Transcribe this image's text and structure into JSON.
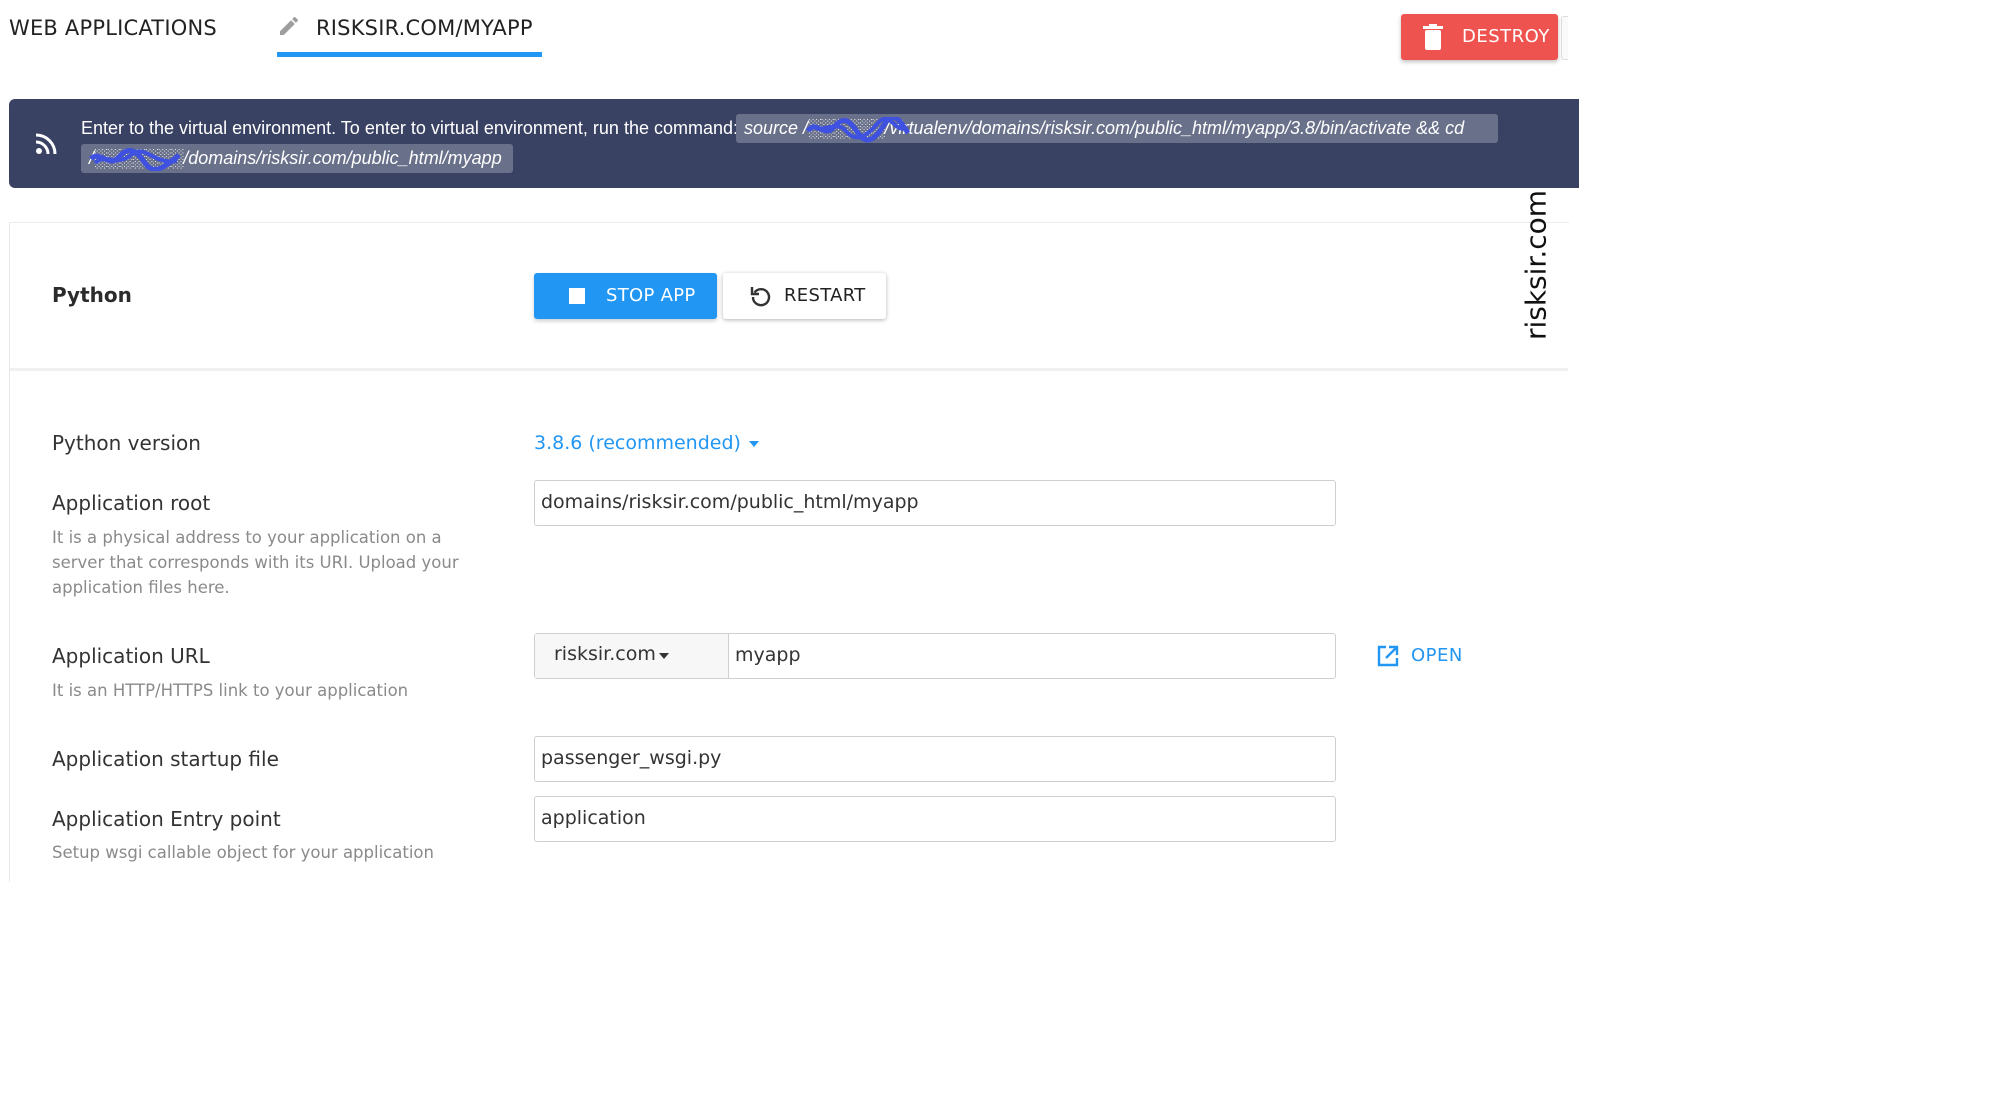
{
  "header": {
    "breadcrumb": "WEB APPLICATIONS",
    "active_tab": "RISKSIR.COM/MYAPP",
    "destroy_label": "DESTROY"
  },
  "banner": {
    "message": "Enter to the virtual environment. To enter to virtual environment, run the command:",
    "command_line1": "source /░░░░░░/virtualenv/domains/risksir.com/public_html/myapp/3.8/bin/activate && cd",
    "command_line2": "/░░░░░░░/domains/risksir.com/public_html/myapp"
  },
  "app": {
    "section_title": "Python",
    "stop_label": "STOP APP",
    "restart_label": "RESTART"
  },
  "watermark": "risksir.com",
  "form": {
    "python_version": {
      "label": "Python version",
      "value": "3.8.6 (recommended)"
    },
    "app_root": {
      "label": "Application root",
      "hint": "It is a physical address to your application on a server that corresponds with its URI. Upload your application files here.",
      "value": "domains/risksir.com/public_html/myapp"
    },
    "app_url": {
      "label": "Application URL",
      "hint": "It is an HTTP/HTTPS link to your application",
      "domain": "risksir.com",
      "path": "myapp",
      "open_label": "OPEN"
    },
    "startup_file": {
      "label": "Application startup file",
      "value": "passenger_wsgi.py"
    },
    "entry_point": {
      "label": "Application Entry point",
      "hint": "Setup wsgi callable object for your application",
      "value": "application"
    }
  },
  "colors": {
    "accent": "#2196f3",
    "danger": "#ef5350",
    "banner_bg": "#3a4263",
    "redaction": "#3f51e0"
  },
  "icons": [
    "pencil-icon",
    "trash-icon",
    "rss-icon",
    "stop-square-icon",
    "restart-icon",
    "chevron-down-icon",
    "external-link-icon"
  ]
}
